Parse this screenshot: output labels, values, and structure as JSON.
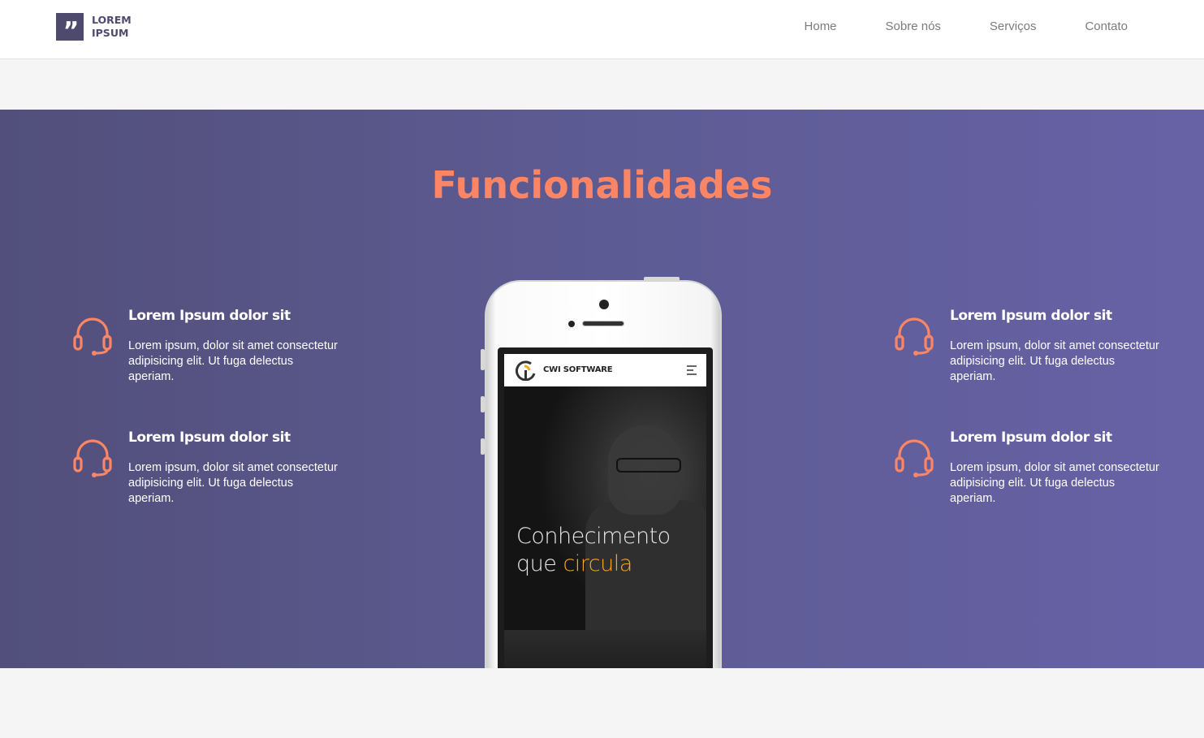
{
  "header": {
    "logo": {
      "mark": "”",
      "line1": "LOREM",
      "line2": "IPSUM"
    },
    "nav": [
      {
        "label": "Home"
      },
      {
        "label": "Sobre nós"
      },
      {
        "label": "Serviços"
      },
      {
        "label": "Contato"
      }
    ]
  },
  "main": {
    "title": "Funcionalidades",
    "features": [
      {
        "icon": "headset-icon",
        "heading": "Lorem Ipsum dolor sit",
        "text": "Lorem ipsum, dolor sit amet consectetur adipisicing elit. Ut fuga delectus aperiam."
      },
      {
        "icon": "headset-icon",
        "heading": "Lorem Ipsum dolor sit",
        "text": "Lorem ipsum, dolor sit amet consectetur adipisicing elit. Ut fuga delectus aperiam."
      },
      {
        "icon": "headset-icon",
        "heading": "Lorem Ipsum dolor sit",
        "text": "Lorem ipsum, dolor sit amet consectetur adipisicing elit. Ut fuga delectus aperiam."
      },
      {
        "icon": "headset-icon",
        "heading": "Lorem Ipsum dolor sit",
        "text": "Lorem ipsum, dolor sit amet consectetur adipisicing elit. Ut fuga delectus aperiam."
      }
    ],
    "phone": {
      "brand": "CWI SOFTWARE",
      "hero_line1": "Conhecimento",
      "hero_line2_prefix": "que ",
      "hero_line2_accent": "circula"
    }
  },
  "colors": {
    "accent": "#fc8566",
    "section_start": "#524f7b",
    "section_end": "#6762a6",
    "logo_bg": "#4d4a6e",
    "hero_accent": "#f6a623"
  }
}
